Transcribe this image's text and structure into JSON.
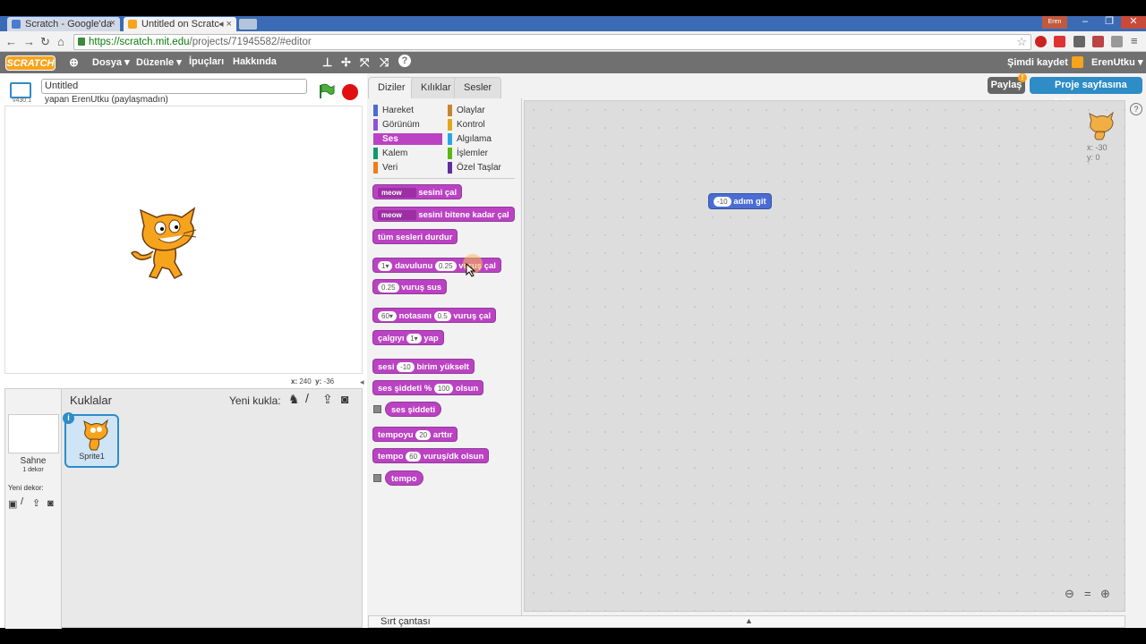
{
  "browser": {
    "tabs": [
      {
        "title": "Scratch - Google'da ",
        "active": false
      },
      {
        "title": "Untitled on Scratc",
        "active": true
      }
    ],
    "window_user": "Eren",
    "url_secure": "https://scratch.mit.edu",
    "url_rest": "/projects/71945582/#editor"
  },
  "menubar": {
    "logo": "SCRATCH",
    "items": [
      "Dosya ▾",
      "Düzenle ▾",
      "İpuçları",
      "Hakkında"
    ],
    "save_now": "Şimdi kaydet",
    "user": "ErenUtku ▾"
  },
  "project": {
    "title": "Untitled",
    "byline": "yapan ErenUtku (paylaşmadın)",
    "version": "v430.1"
  },
  "stage": {
    "coords_x_label": "x:",
    "coords_x": "240",
    "coords_y_label": "y:",
    "coords_y": "-36"
  },
  "sprites_panel": {
    "header": "Kuklalar",
    "new_sprite": "Yeni kukla:",
    "stage_label": "Sahne",
    "stage_backdrops": "1 dekor",
    "new_backdrop": "Yeni dekor:",
    "sprite_name": "Sprite1",
    "info": "i"
  },
  "tabs": [
    "Diziler",
    "Kılıklar",
    "Sesler"
  ],
  "share": {
    "share_label": "Paylaş",
    "project_page": "Proje sayfasına bak"
  },
  "categories": [
    {
      "label": "Hareket",
      "color": "#4a6cd4"
    },
    {
      "label": "Olaylar",
      "color": "#c88330"
    },
    {
      "label": "Görünüm",
      "color": "#8a55d7"
    },
    {
      "label": "Kontrol",
      "color": "#e1a91a"
    },
    {
      "label": "Ses",
      "color": "#bb42c3",
      "selected": true
    },
    {
      "label": "Algılama",
      "color": "#2ca5e2"
    },
    {
      "label": "Kalem",
      "color": "#0e9a6c"
    },
    {
      "label": "İşlemler",
      "color": "#5cb712"
    },
    {
      "label": "Veri",
      "color": "#ee7d16"
    },
    {
      "label": "Özel Taşlar",
      "color": "#632d99"
    }
  ],
  "blocks": {
    "b1_dd": "meow",
    "b1_text": "sesini çal",
    "b2_dd": "meow",
    "b2_text": "sesini bitene kadar çal",
    "b3_text": "tüm sesleri durdur",
    "b4_dd": "1▾",
    "b4_text1": "davulunu",
    "b4_pill": "0.25",
    "b4_text2": "vuruş çal",
    "b5_pill": "0.25",
    "b5_text": "vuruş sus",
    "b6_dd": "60▾",
    "b6_text1": "notasını",
    "b6_pill": "0.5",
    "b6_text2": "vuruş çal",
    "b7_text1": "çalgıyı",
    "b7_dd": "1▾",
    "b7_text2": "yap",
    "b8_text1": "sesi",
    "b8_pill": "-10",
    "b8_text2": "birim yükselt",
    "b9_text1": "ses şiddeti %",
    "b9_pill": "100",
    "b9_text2": "olsun",
    "b10_text": "ses şiddeti",
    "b11_text1": "tempoyu",
    "b11_pill": "20",
    "b11_text2": "arttır",
    "b12_text1": "tempo",
    "b12_pill": "60",
    "b12_text2": "vuruş/dk olsun",
    "b13_text": "tempo"
  },
  "scripts_area": {
    "motion_pill": "-10",
    "motion_text": "adım git",
    "sprite_x": "x: -30",
    "sprite_y": "y: 0"
  },
  "backpack": "Sırt çantası"
}
